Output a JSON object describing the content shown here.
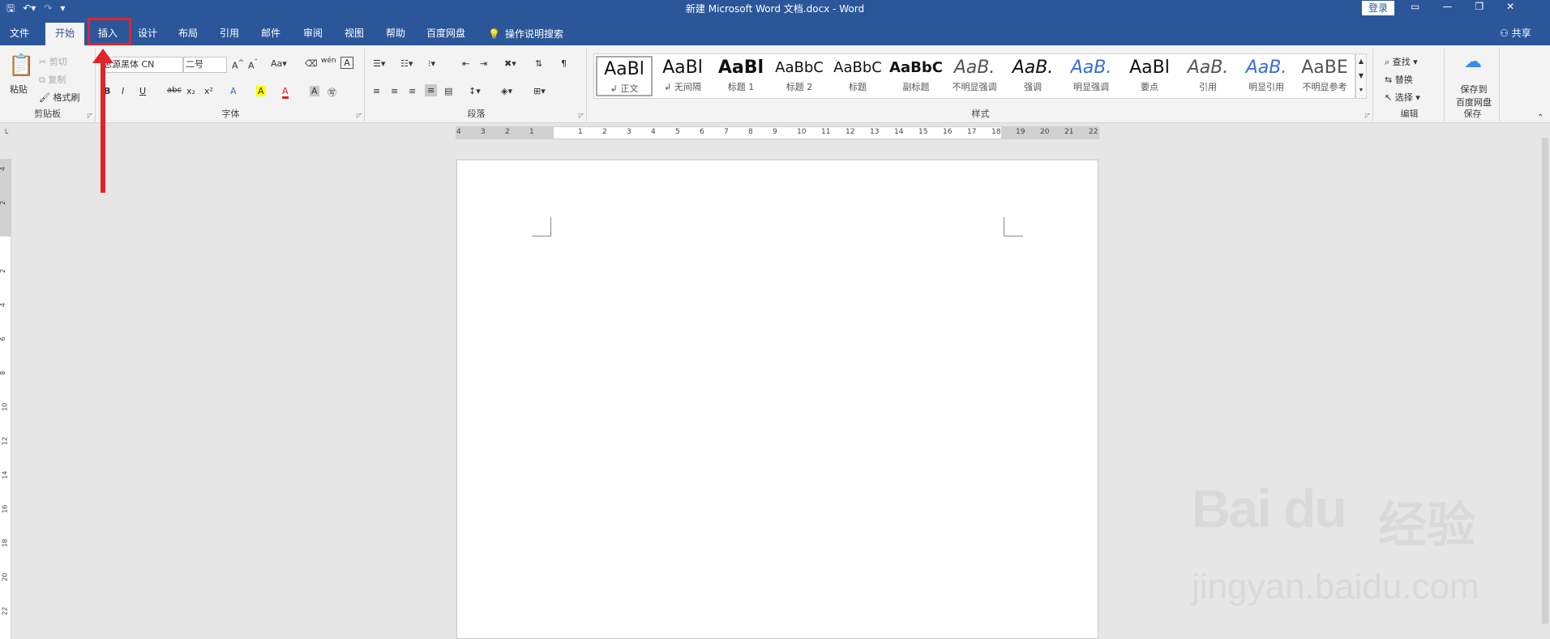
{
  "window": {
    "title": "新建 Microsoft Word 文档.docx  -  Word",
    "login": "登录",
    "controls": [
      "▭",
      "—",
      "❐",
      "✕"
    ]
  },
  "qat": {
    "save_icon": "save-icon",
    "undo_icon": "undo-icon",
    "redo_icon": "redo-icon",
    "customize_icon": "customize-icon"
  },
  "tabs": [
    {
      "label": "文件"
    },
    {
      "label": "开始",
      "active": true
    },
    {
      "label": "插入"
    },
    {
      "label": "设计"
    },
    {
      "label": "布局"
    },
    {
      "label": "引用"
    },
    {
      "label": "邮件"
    },
    {
      "label": "审阅"
    },
    {
      "label": "视图"
    },
    {
      "label": "帮助"
    },
    {
      "label": "百度网盘"
    }
  ],
  "tell_me": "操作说明搜索",
  "share": "共享",
  "clipboard": {
    "paste": "粘贴",
    "cut": "剪切",
    "copy": "复制",
    "format_painter": "格式刷",
    "label": "剪贴板"
  },
  "font": {
    "name": "思源黑体 CN",
    "size": "二号",
    "label": "字体",
    "buttons": [
      "B",
      "I",
      "U",
      "abc",
      "x₂",
      "x²",
      "A",
      "A",
      "A",
      "A",
      "Aa",
      "wén"
    ]
  },
  "paragraph": {
    "label": "段落"
  },
  "styles": {
    "label": "样式",
    "items": [
      {
        "sample": "AaBl",
        "name": "↲ 正文"
      },
      {
        "sample": "AaBl",
        "name": "↲ 无间隔"
      },
      {
        "sample": "AaBl",
        "name": "标题 1"
      },
      {
        "sample": "AaBbC",
        "name": "标题 2"
      },
      {
        "sample": "AaBbC",
        "name": "标题"
      },
      {
        "sample": "AaBbC",
        "name": "副标题"
      },
      {
        "sample": "AaB.",
        "name": "不明显强调"
      },
      {
        "sample": "AaB.",
        "name": "强调"
      },
      {
        "sample": "AaB.",
        "name": "明显强调"
      },
      {
        "sample": "AaBl",
        "name": "要点"
      },
      {
        "sample": "AaB.",
        "name": "引用"
      },
      {
        "sample": "AaB.",
        "name": "明显引用"
      },
      {
        "sample": "AaBE",
        "name": "不明显参考"
      }
    ]
  },
  "editing": {
    "find": "查找",
    "replace": "替换",
    "select": "选择",
    "label": "编辑"
  },
  "save_group": {
    "save_to": "保存到",
    "baidu": "百度网盘",
    "label": "保存"
  },
  "hruler_numbers": [
    "4",
    "3",
    "2",
    "1",
    "",
    "1",
    "2",
    "3",
    "4",
    "5",
    "6",
    "7",
    "8",
    "9",
    "10",
    "11",
    "12",
    "13",
    "14",
    "15",
    "16",
    "17",
    "18",
    "19",
    "20",
    "21",
    "22"
  ],
  "vruler_numbers": [
    "4",
    "2",
    "",
    "2",
    "4",
    "6",
    "8",
    "10",
    "12",
    "14",
    "16",
    "18",
    "20",
    "22"
  ],
  "watermark": {
    "logo": "Bai du",
    "cn": "经验",
    "url": "jingyan.baidu.com"
  },
  "colors": {
    "brand": "#2b579a",
    "highlight": "#e0242a"
  }
}
